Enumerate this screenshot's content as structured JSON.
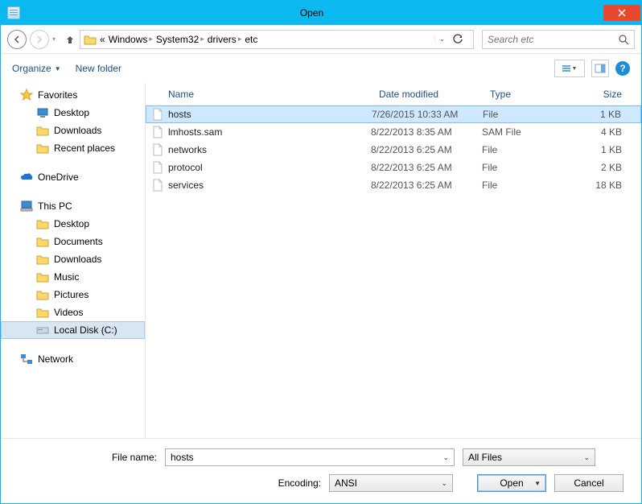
{
  "title": "Open",
  "breadcrumbs": {
    "prefix": "«",
    "items": [
      "Windows",
      "System32",
      "drivers",
      "etc"
    ]
  },
  "search": {
    "placeholder": "Search etc"
  },
  "toolbar": {
    "organize": "Organize",
    "newfolder": "New folder"
  },
  "sidebar": {
    "favorites": {
      "label": "Favorites",
      "items": [
        "Desktop",
        "Downloads",
        "Recent places"
      ]
    },
    "onedrive": {
      "label": "OneDrive"
    },
    "thispc": {
      "label": "This PC",
      "items": [
        "Desktop",
        "Documents",
        "Downloads",
        "Music",
        "Pictures",
        "Videos",
        "Local Disk (C:)"
      ],
      "selected_index": 6
    },
    "network": {
      "label": "Network"
    }
  },
  "columns": {
    "name": "Name",
    "date": "Date modified",
    "type": "Type",
    "size": "Size"
  },
  "files": [
    {
      "name": "hosts",
      "date": "7/26/2015 10:33 AM",
      "type": "File",
      "size": "1 KB",
      "selected": true
    },
    {
      "name": "lmhosts.sam",
      "date": "8/22/2013 8:35 AM",
      "type": "SAM File",
      "size": "4 KB",
      "selected": false
    },
    {
      "name": "networks",
      "date": "8/22/2013 6:25 AM",
      "type": "File",
      "size": "1 KB",
      "selected": false
    },
    {
      "name": "protocol",
      "date": "8/22/2013 6:25 AM",
      "type": "File",
      "size": "2 KB",
      "selected": false
    },
    {
      "name": "services",
      "date": "8/22/2013 6:25 AM",
      "type": "File",
      "size": "18 KB",
      "selected": false
    }
  ],
  "bottom": {
    "filename_label": "File name:",
    "filename_value": "hosts",
    "filter_value": "All Files",
    "encoding_label": "Encoding:",
    "encoding_value": "ANSI",
    "open": "Open",
    "cancel": "Cancel"
  }
}
